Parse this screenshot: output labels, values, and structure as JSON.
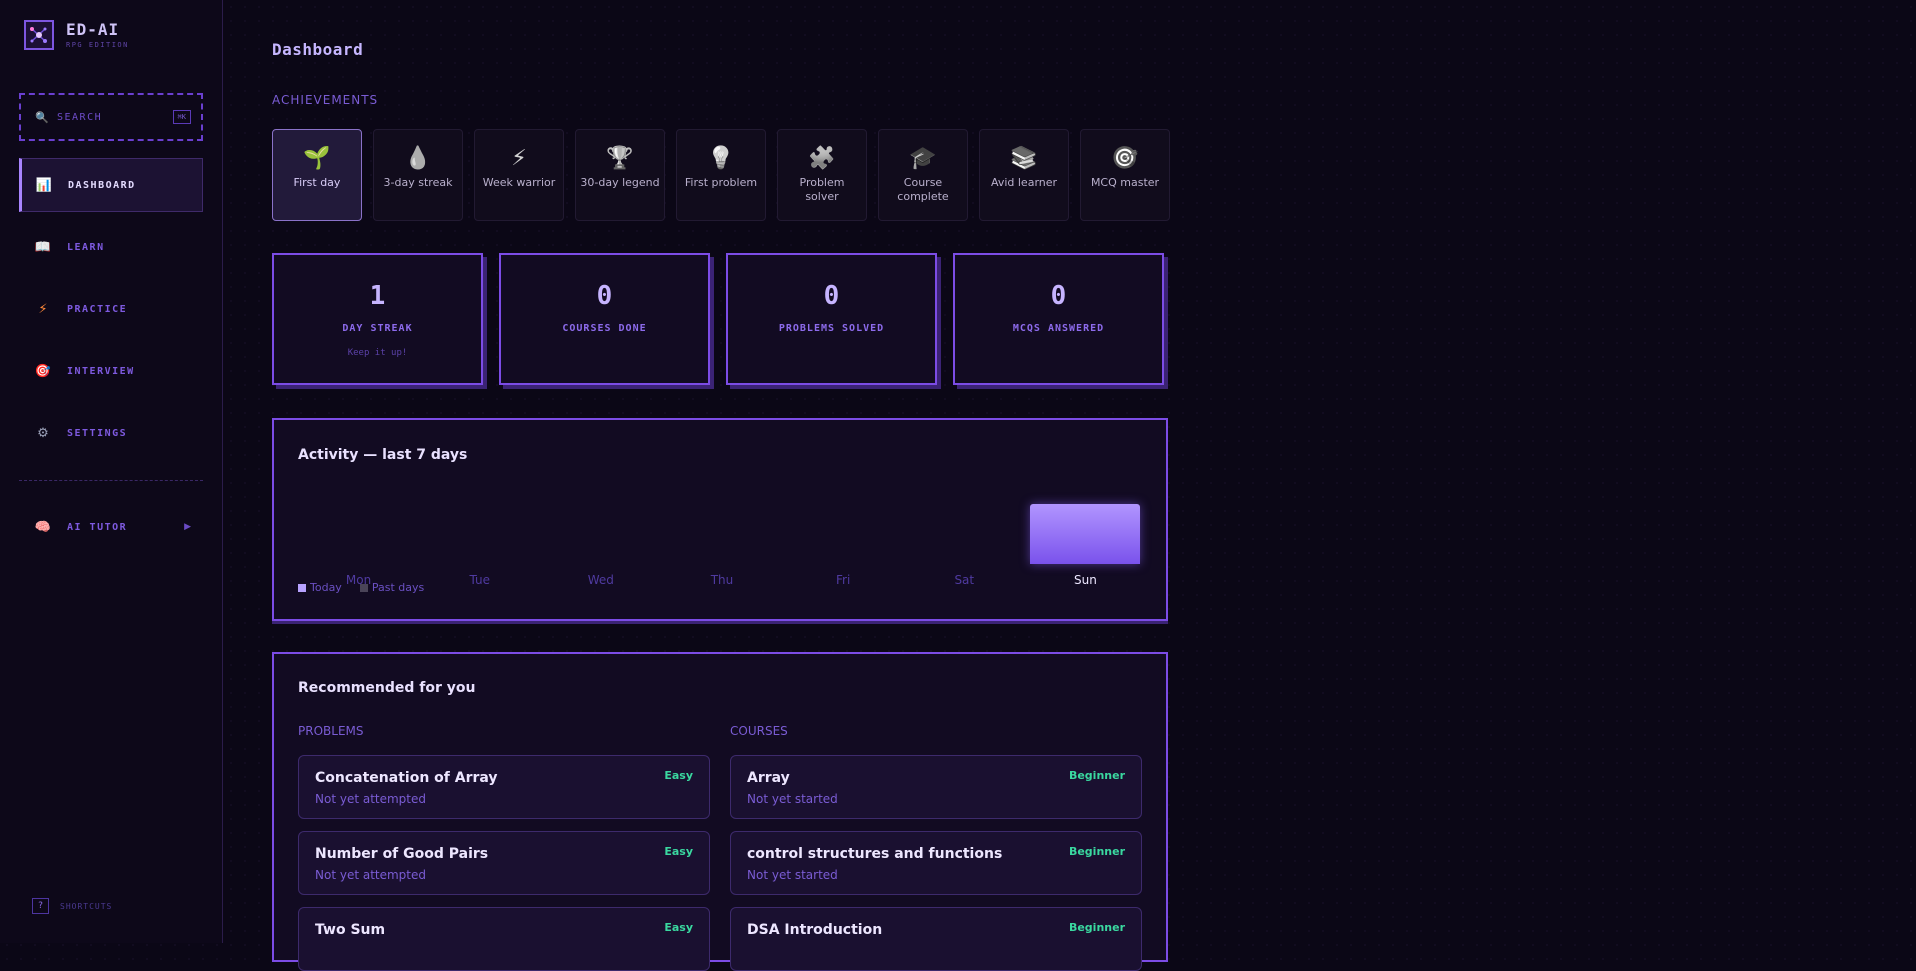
{
  "brand": {
    "title": "ED-AI",
    "subtitle": "RPG EDITION"
  },
  "search": {
    "placeholder": "SEARCH",
    "shortcut": "⌘K"
  },
  "nav": {
    "items": [
      {
        "label": "DASHBOARD",
        "icon": "bar-chart-icon"
      },
      {
        "label": "LEARN",
        "icon": "book-icon"
      },
      {
        "label": "PRACTICE",
        "icon": "lightning-icon"
      },
      {
        "label": "INTERVIEW",
        "icon": "target-icon"
      },
      {
        "label": "SETTINGS",
        "icon": "gear-icon"
      }
    ],
    "ai_tutor": {
      "label": "AI TUTOR",
      "icon": "brain-icon",
      "arrow": "▶"
    }
  },
  "shortcuts": {
    "key": "?",
    "label": "SHORTCUTS"
  },
  "page": {
    "title": "Dashboard"
  },
  "achievements": {
    "label": "ACHIEVEMENTS",
    "items": [
      {
        "label": "First day",
        "icon": "🌱",
        "unlocked": true
      },
      {
        "label": "3-day streak",
        "icon": "💧",
        "unlocked": false
      },
      {
        "label": "Week warrior",
        "icon": "⚡",
        "unlocked": false
      },
      {
        "label": "30-day legend",
        "icon": "🏆",
        "unlocked": false
      },
      {
        "label": "First problem",
        "icon": "💡",
        "unlocked": false
      },
      {
        "label": "Problem solver",
        "icon": "🧩",
        "unlocked": false
      },
      {
        "label": "Course complete",
        "icon": "🎓",
        "unlocked": false
      },
      {
        "label": "Avid learner",
        "icon": "📚",
        "unlocked": false
      },
      {
        "label": "MCQ master",
        "icon": "🎯",
        "unlocked": false
      }
    ]
  },
  "stats": [
    {
      "value": "1",
      "label": "DAY STREAK",
      "note": "Keep it up!"
    },
    {
      "value": "0",
      "label": "COURSES DONE",
      "note": ""
    },
    {
      "value": "0",
      "label": "PROBLEMS SOLVED",
      "note": ""
    },
    {
      "value": "0",
      "label": "MCQS ANSWERED",
      "note": ""
    }
  ],
  "activity": {
    "title": "Activity — last 7 days",
    "days": [
      "Mon",
      "Tue",
      "Wed",
      "Thu",
      "Fri",
      "Sat",
      "Sun"
    ],
    "values": [
      0,
      0,
      0,
      0,
      0,
      0,
      1
    ],
    "today_index": 6,
    "legend": {
      "today": "Today",
      "past": "Past days"
    },
    "colors": {
      "today": "#b7a2ff",
      "past": "#4a4458"
    }
  },
  "recommended": {
    "title": "Recommended for you",
    "problems_label": "PROBLEMS",
    "courses_label": "COURSES",
    "problems": [
      {
        "title": "Concatenation of Array",
        "status": "Not yet attempted",
        "badge": "Easy"
      },
      {
        "title": "Number of Good Pairs",
        "status": "Not yet attempted",
        "badge": "Easy"
      },
      {
        "title": "Two Sum",
        "status": "",
        "badge": "Easy"
      }
    ],
    "courses": [
      {
        "title": "Array",
        "status": "Not yet started",
        "badge": "Beginner"
      },
      {
        "title": "control structures and functions",
        "status": "Not yet started",
        "badge": "Beginner"
      },
      {
        "title": "DSA Introduction",
        "status": "",
        "badge": "Beginner"
      }
    ]
  }
}
